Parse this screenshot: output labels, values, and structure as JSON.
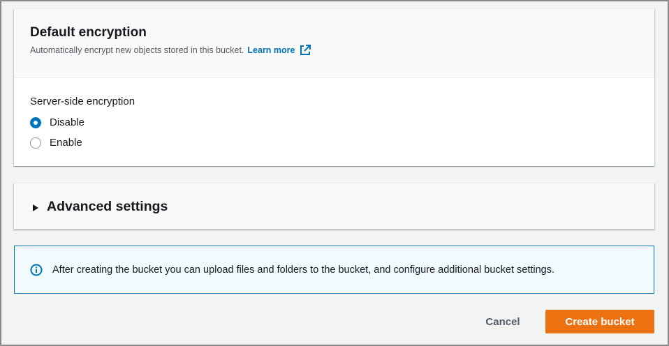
{
  "encryption": {
    "title": "Default encryption",
    "description": "Automatically encrypt new objects stored in this bucket.",
    "learn_more": "Learn more",
    "field_label": "Server-side encryption",
    "options": [
      {
        "label": "Disable",
        "selected": true
      },
      {
        "label": "Enable",
        "selected": false
      }
    ]
  },
  "advanced": {
    "title": "Advanced settings",
    "expanded": false
  },
  "info": {
    "text": "After creating the bucket you can upload files and folders to the bucket, and configure additional bucket settings."
  },
  "actions": {
    "cancel_label": "Cancel",
    "create_label": "Create bucket"
  },
  "colors": {
    "primary_button": "#ec7211",
    "link": "#0073bb",
    "info_border": "#0073bb",
    "info_background": "#f1faff"
  },
  "icons": {
    "external_link": "external-link-icon",
    "caret": "caret-right-icon",
    "info": "info-circle-icon"
  }
}
